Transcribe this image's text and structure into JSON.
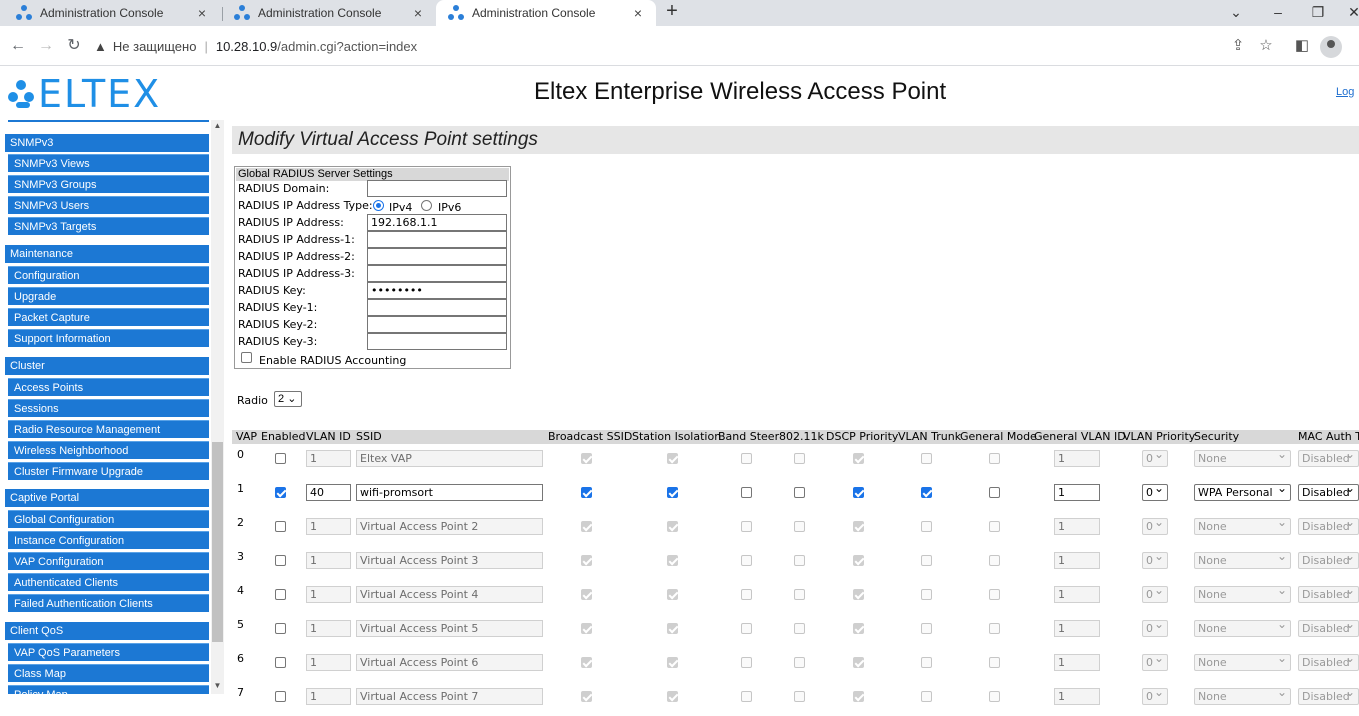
{
  "browser": {
    "tabs": [
      {
        "title": "Administration Console",
        "close": "×"
      },
      {
        "title": "Administration Console",
        "close": "×"
      },
      {
        "title": "Administration Console",
        "close": "×"
      }
    ],
    "new_tab": "+",
    "insecure_label": "Не защищено",
    "url_host": "10.28.10.9",
    "url_path": "/admin.cgi?action=index"
  },
  "header": {
    "logo_text": "ELTEX",
    "title": "Eltex Enterprise Wireless Access Point",
    "logout": "Log"
  },
  "sidebar": {
    "sections": [
      {
        "header": "SNMPv3",
        "items": [
          "SNMPv3 Views",
          "SNMPv3 Groups",
          "SNMPv3 Users",
          "SNMPv3 Targets"
        ]
      },
      {
        "header": "Maintenance",
        "items": [
          "Configuration",
          "Upgrade",
          "Packet Capture",
          "Support Information"
        ]
      },
      {
        "header": "Cluster",
        "items": [
          "Access Points",
          "Sessions",
          "Radio Resource Management",
          "Wireless Neighborhood",
          "Cluster Firmware Upgrade"
        ]
      },
      {
        "header": "Captive Portal",
        "items": [
          "Global Configuration",
          "Instance Configuration",
          "VAP Configuration",
          "Authenticated Clients",
          "Failed Authentication Clients"
        ]
      },
      {
        "header": "Client QoS",
        "items": [
          "VAP QoS Parameters",
          "Class Map",
          "Policy Map"
        ]
      }
    ]
  },
  "main": {
    "title": "Modify Virtual Access Point settings",
    "radius": {
      "header": "Global RADIUS Server Settings",
      "domain_label": "RADIUS Domain:",
      "domain_value": "",
      "ip_type_label": "RADIUS IP Address Type:",
      "ipv4_label": "IPv4",
      "ipv6_label": "IPv6",
      "ip_label": "RADIUS IP Address:",
      "ip_value": "192.168.1.1",
      "ip1_label": "RADIUS IP Address-1:",
      "ip2_label": "RADIUS IP Address-2:",
      "ip3_label": "RADIUS IP Address-3:",
      "key_label": "RADIUS Key:",
      "key_value": "••••••••",
      "key1_label": "RADIUS Key-1:",
      "key2_label": "RADIUS Key-2:",
      "key3_label": "RADIUS Key-3:",
      "accounting_label": "Enable RADIUS Accounting"
    },
    "radio_label": "Radio",
    "radio_value": "2",
    "table": {
      "columns": [
        "VAP",
        "Enabled",
        "VLAN ID",
        "SSID",
        "Broadcast SSID",
        "Station Isolation",
        "Band Steer",
        "802.11k",
        "DSCP Priority",
        "VLAN Trunk",
        "General Mode",
        "General VLAN ID",
        "VLAN Priority",
        "Security",
        "MAC Auth Ty"
      ],
      "rows": [
        {
          "vap": "0",
          "enabled": false,
          "vlan": "1",
          "ssid": "Eltex VAP",
          "bcast": true,
          "iso": true,
          "band": false,
          "k": false,
          "dscp": true,
          "trunk": false,
          "gmode": false,
          "gvlan": "1",
          "prio": "0",
          "security": "None",
          "macauth": "Disabled",
          "active": false
        },
        {
          "vap": "1",
          "enabled": true,
          "vlan": "40",
          "ssid": "wifi-promsort",
          "bcast": true,
          "iso": true,
          "band": false,
          "k": false,
          "dscp": true,
          "trunk": true,
          "gmode": false,
          "gvlan": "1",
          "prio": "0",
          "security": "WPA Personal",
          "macauth": "Disabled",
          "active": true
        },
        {
          "vap": "2",
          "enabled": false,
          "vlan": "1",
          "ssid": "Virtual Access Point 2",
          "bcast": true,
          "iso": true,
          "band": false,
          "k": false,
          "dscp": true,
          "trunk": false,
          "gmode": false,
          "gvlan": "1",
          "prio": "0",
          "security": "None",
          "macauth": "Disabled",
          "active": false
        },
        {
          "vap": "3",
          "enabled": false,
          "vlan": "1",
          "ssid": "Virtual Access Point 3",
          "bcast": true,
          "iso": true,
          "band": false,
          "k": false,
          "dscp": true,
          "trunk": false,
          "gmode": false,
          "gvlan": "1",
          "prio": "0",
          "security": "None",
          "macauth": "Disabled",
          "active": false
        },
        {
          "vap": "4",
          "enabled": false,
          "vlan": "1",
          "ssid": "Virtual Access Point 4",
          "bcast": true,
          "iso": true,
          "band": false,
          "k": false,
          "dscp": true,
          "trunk": false,
          "gmode": false,
          "gvlan": "1",
          "prio": "0",
          "security": "None",
          "macauth": "Disabled",
          "active": false
        },
        {
          "vap": "5",
          "enabled": false,
          "vlan": "1",
          "ssid": "Virtual Access Point 5",
          "bcast": true,
          "iso": true,
          "band": false,
          "k": false,
          "dscp": true,
          "trunk": false,
          "gmode": false,
          "gvlan": "1",
          "prio": "0",
          "security": "None",
          "macauth": "Disabled",
          "active": false
        },
        {
          "vap": "6",
          "enabled": false,
          "vlan": "1",
          "ssid": "Virtual Access Point 6",
          "bcast": true,
          "iso": true,
          "band": false,
          "k": false,
          "dscp": true,
          "trunk": false,
          "gmode": false,
          "gvlan": "1",
          "prio": "0",
          "security": "None",
          "macauth": "Disabled",
          "active": false
        },
        {
          "vap": "7",
          "enabled": false,
          "vlan": "1",
          "ssid": "Virtual Access Point 7",
          "bcast": true,
          "iso": true,
          "band": false,
          "k": false,
          "dscp": true,
          "trunk": false,
          "gmode": false,
          "gvlan": "1",
          "prio": "0",
          "security": "None",
          "macauth": "Disabled",
          "active": false
        }
      ]
    }
  },
  "colors": {
    "sidebar_blue": "#1c78d4",
    "logo_blue": "#1f8fe6",
    "check_blue": "#1a73e8"
  }
}
